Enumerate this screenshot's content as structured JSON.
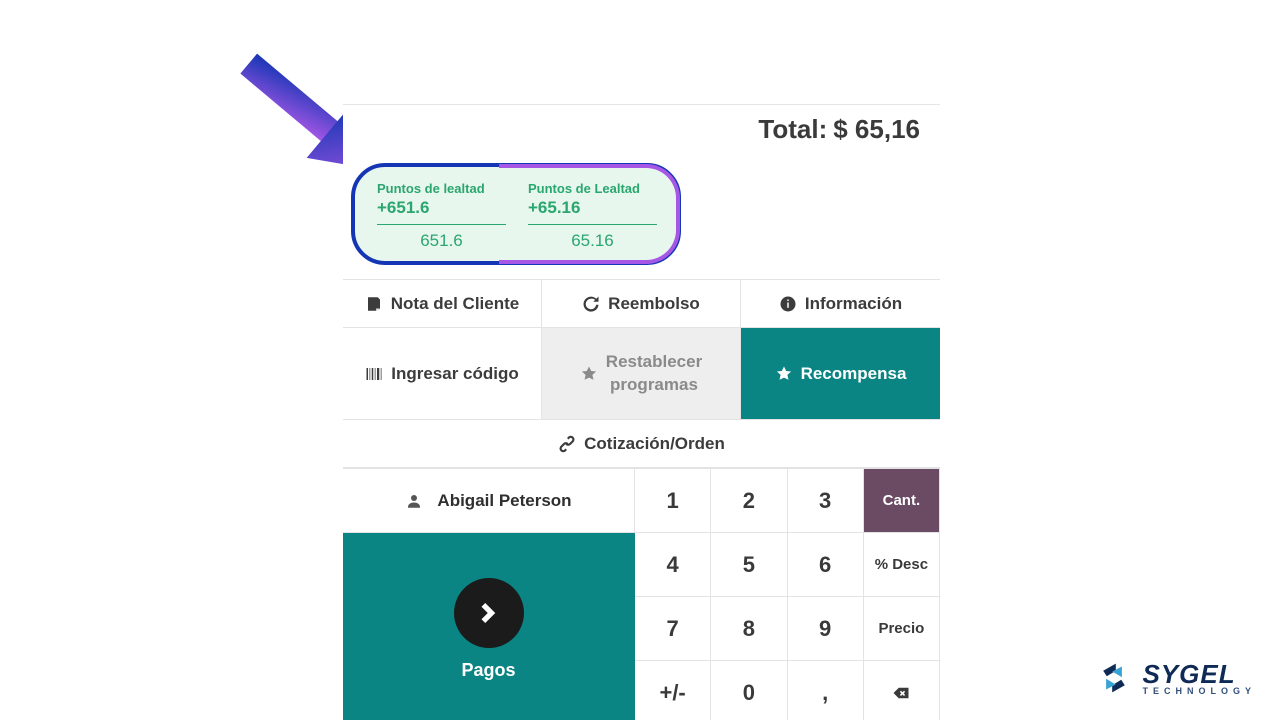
{
  "total": {
    "label": "Total:",
    "amount": "$ 65,16"
  },
  "loyalty": {
    "left": {
      "title": "Puntos de lealtad",
      "add": "+651.6",
      "total": "651.6"
    },
    "right": {
      "title": "Puntos de Lealtad",
      "add": "+65.16",
      "total": "65.16"
    }
  },
  "actions": {
    "note": "Nota del Cliente",
    "refund": "Reembolso",
    "info": "Información",
    "code": "Ingresar código",
    "reset1": "Restablecer",
    "reset2": "programas",
    "reward": "Recompensa",
    "quote": "Cotización/Orden"
  },
  "customer": {
    "name": "Abigail Peterson"
  },
  "pay": {
    "label": "Pagos"
  },
  "keypad": {
    "k1": "1",
    "k2": "2",
    "k3": "3",
    "qty": "Cant.",
    "k4": "4",
    "k5": "5",
    "k6": "6",
    "disc": "% Desc",
    "k7": "7",
    "k8": "8",
    "k9": "9",
    "price": "Precio",
    "sign": "+/-",
    "k0": "0",
    "dec": ","
  },
  "brand": {
    "name": "SYGEL",
    "sub": "TECHNOLOGY"
  }
}
